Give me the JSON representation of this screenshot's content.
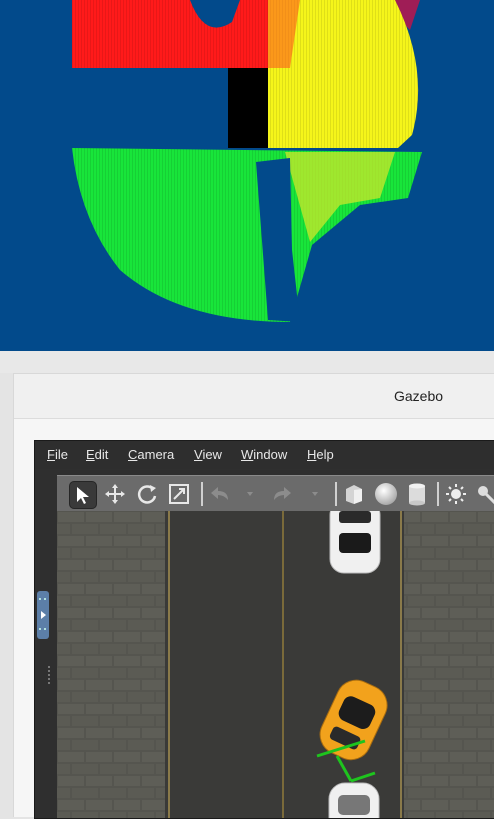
{
  "window": {
    "title": "Gazebo"
  },
  "menu": [
    {
      "label": "File",
      "accel": "F",
      "rest": "ile"
    },
    {
      "label": "Edit",
      "accel": "E",
      "rest": "dit"
    },
    {
      "label": "Camera",
      "accel": "C",
      "rest": "amera"
    },
    {
      "label": "View",
      "accel": "V",
      "rest": "iew"
    },
    {
      "label": "Window",
      "accel": "W",
      "rest": "indow"
    },
    {
      "label": "Help",
      "accel": "H",
      "rest": "elp"
    }
  ],
  "toolbar": {
    "tools": [
      "select-arrow-icon",
      "translate-icon",
      "rotate-icon",
      "scale-icon",
      "undo-icon",
      "dropdown-arrow-icon",
      "redo-icon",
      "dropdown-arrow-icon",
      "box-shape-icon",
      "sphere-shape-icon",
      "cylinder-shape-icon",
      "sun-light-icon",
      "spot-light-icon"
    ],
    "active_tool": "select-arrow-icon"
  },
  "colors": {
    "background": "#024a8b",
    "laser_red": "#ff1a1a",
    "laser_yellow": "#f5f51a",
    "laser_green": "#18e53a",
    "road": "#3a3a38",
    "car_orange": "#f2a21c"
  }
}
